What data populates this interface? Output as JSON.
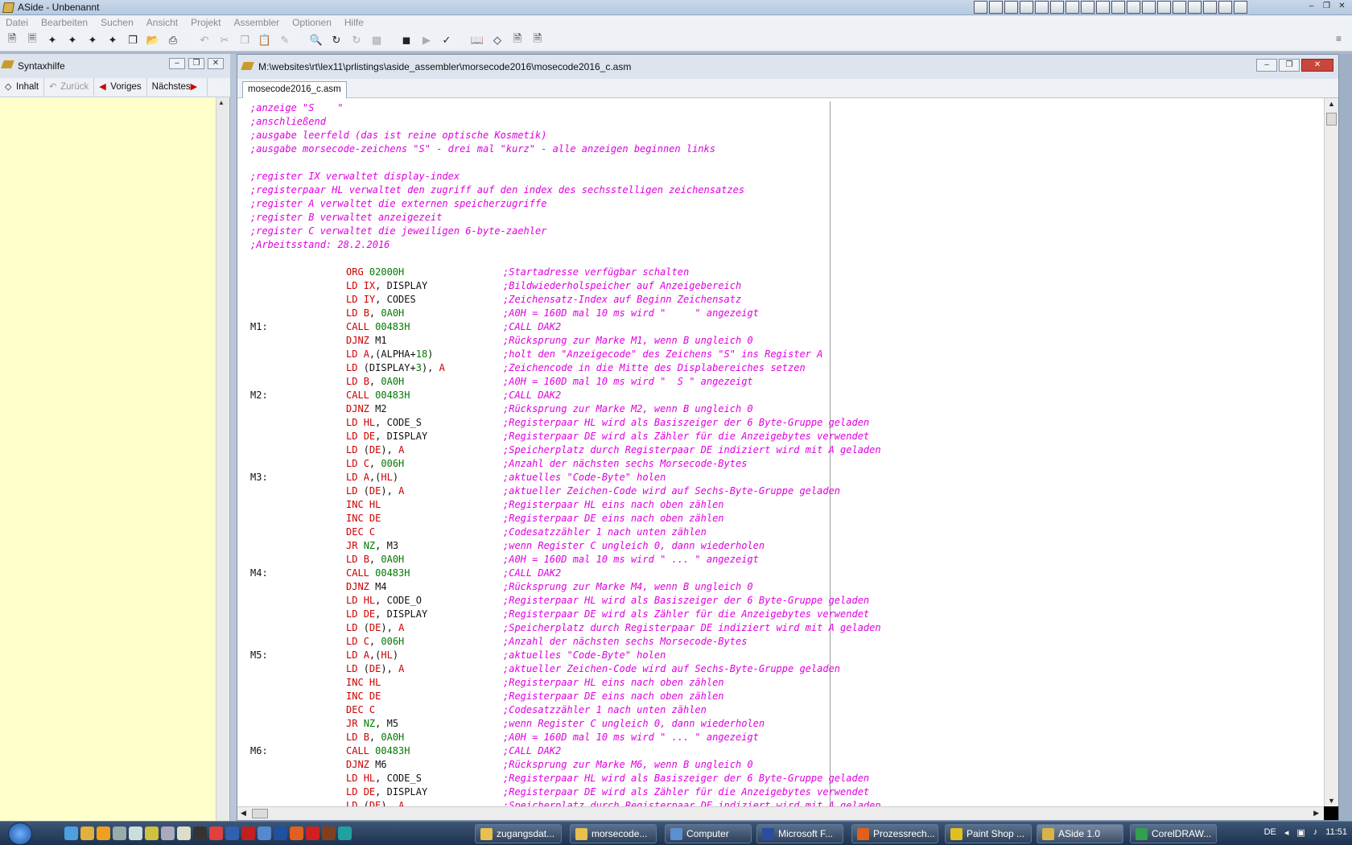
{
  "window": {
    "title": "ASide - Unbenannt"
  },
  "menu": [
    "Datei",
    "Bearbeiten",
    "Suchen",
    "Ansicht",
    "Projekt",
    "Assembler",
    "Optionen",
    "Hilfe"
  ],
  "left_panel": {
    "title": "Syntaxhilfe",
    "buttons": {
      "contents": "Inhalt",
      "back": "Zurück",
      "prev": "Voriges",
      "next": "Nächstes"
    }
  },
  "editor": {
    "path": "M:\\websites\\rt\\lex11\\prlistings\\aside_assembler\\morsecode2016\\mosecode2016_c.asm",
    "tab": "mosecode2016_c.asm",
    "header_comments": [
      ";anzeige \"S    \"",
      ";anschließend",
      ";ausgabe leerfeld (das ist reine optische Kosmetik)",
      ";ausgabe morsecode-zeichens \"S\" - drei mal \"kurz\" - alle anzeigen beginnen links",
      "",
      ";register IX verwaltet display-index",
      ";registerpaar HL verwaltet den zugriff auf den index des sechsstelligen zeichensatzes",
      ";register A verwaltet die externen speicherzugriffe",
      ";register B verwaltet anzeigezeit",
      ";register C verwaltet die jeweiligen 6-byte-zaehler",
      ";Arbeitsstand: 28.2.2016",
      ""
    ],
    "code": [
      {
        "label": "",
        "op": "ORG",
        "args": [
          [
            "num",
            "02000H"
          ]
        ],
        "comment": ";Startadresse verfügbar schalten"
      },
      {
        "label": "",
        "op": "LD",
        "args": [
          [
            "rg",
            "IX"
          ],
          [
            "op",
            ", DISPLAY"
          ]
        ],
        "comment": ";Bildwiederholspeicher auf Anzeigebereich"
      },
      {
        "label": "",
        "op": "LD",
        "args": [
          [
            "rg",
            "IY"
          ],
          [
            "op",
            ", CODES"
          ]
        ],
        "comment": ";Zeichensatz-Index auf Beginn Zeichensatz"
      },
      {
        "label": "",
        "op": "LD",
        "args": [
          [
            "rg",
            "B"
          ],
          [
            "op",
            ", "
          ],
          [
            "num",
            "0A0H"
          ]
        ],
        "comment": ";A0H = 160D mal 10 ms wird \"     \" angezeigt"
      },
      {
        "label": "M1:",
        "op": "CALL",
        "args": [
          [
            "num",
            "00483H"
          ]
        ],
        "comment": ";CALL DAK2"
      },
      {
        "label": "",
        "op": "DJNZ",
        "args": [
          [
            "op",
            "M1"
          ]
        ],
        "comment": ";Rücksprung zur Marke M1, wenn B ungleich 0"
      },
      {
        "label": "",
        "op": "LD",
        "args": [
          [
            "rg",
            "A"
          ],
          [
            "op",
            ",(ALPHA+"
          ],
          [
            "num",
            "18"
          ],
          [
            "op",
            ")"
          ]
        ],
        "comment": ";holt den \"Anzeigecode\" des Zeichens \"S\" ins Register A"
      },
      {
        "label": "",
        "op": "LD",
        "args": [
          [
            "op",
            "(DISPLAY+"
          ],
          [
            "num",
            "3"
          ],
          [
            "op",
            "), "
          ],
          [
            "rg",
            "A"
          ]
        ],
        "comment": ";Zeichencode in die Mitte des Displabereiches setzen"
      },
      {
        "label": "",
        "op": "LD",
        "args": [
          [
            "rg",
            "B"
          ],
          [
            "op",
            ", "
          ],
          [
            "num",
            "0A0H"
          ]
        ],
        "comment": ";A0H = 160D mal 10 ms wird \"  S \" angezeigt"
      },
      {
        "label": "M2:",
        "op": "CALL",
        "args": [
          [
            "num",
            "00483H"
          ]
        ],
        "comment": ";CALL DAK2"
      },
      {
        "label": "",
        "op": "DJNZ",
        "args": [
          [
            "op",
            "M2"
          ]
        ],
        "comment": ";Rücksprung zur Marke M2, wenn B ungleich 0"
      },
      {
        "label": "",
        "op": "LD",
        "args": [
          [
            "rg",
            "HL"
          ],
          [
            "op",
            ", CODE_S"
          ]
        ],
        "comment": ";Registerpaar HL wird als Basiszeiger der 6 Byte-Gruppe geladen"
      },
      {
        "label": "",
        "op": "LD",
        "args": [
          [
            "rg",
            "DE"
          ],
          [
            "op",
            ", DISPLAY"
          ]
        ],
        "comment": ";Registerpaar DE wird als Zähler für die Anzeigebytes verwendet"
      },
      {
        "label": "",
        "op": "LD",
        "args": [
          [
            "op",
            "("
          ],
          [
            "rg",
            "DE"
          ],
          [
            "op",
            "), "
          ],
          [
            "rg",
            "A"
          ]
        ],
        "comment": ";Speicherplatz durch Registerpaar DE indiziert wird mit A geladen"
      },
      {
        "label": "",
        "op": "LD",
        "args": [
          [
            "rg",
            "C"
          ],
          [
            "op",
            ", "
          ],
          [
            "num",
            "006H"
          ]
        ],
        "comment": ";Anzahl der nächsten sechs Morsecode-Bytes"
      },
      {
        "label": "M3:",
        "op": "LD",
        "args": [
          [
            "rg",
            "A"
          ],
          [
            "op",
            ",("
          ],
          [
            "rg",
            "HL"
          ],
          [
            "op",
            ")"
          ]
        ],
        "comment": ";aktuelles \"Code-Byte\" holen"
      },
      {
        "label": "",
        "op": "LD",
        "args": [
          [
            "op",
            "("
          ],
          [
            "rg",
            "DE"
          ],
          [
            "op",
            "), "
          ],
          [
            "rg",
            "A"
          ]
        ],
        "comment": ";aktueller Zeichen-Code wird auf Sechs-Byte-Gruppe geladen"
      },
      {
        "label": "",
        "op": "INC",
        "args": [
          [
            "rg",
            "HL"
          ]
        ],
        "comment": ";Registerpaar HL eins nach oben zählen"
      },
      {
        "label": "",
        "op": "INC",
        "args": [
          [
            "rg",
            "DE"
          ]
        ],
        "comment": ";Registerpaar DE eins nach oben zählen"
      },
      {
        "label": "",
        "op": "DEC",
        "args": [
          [
            "rg",
            "C"
          ]
        ],
        "comment": ";Codesatzzähler 1 nach unten zählen"
      },
      {
        "label": "",
        "op": "JR",
        "args": [
          [
            "num",
            "NZ"
          ],
          [
            "op",
            ", M3"
          ]
        ],
        "comment": ";wenn Register C ungleich 0, dann wiederholen"
      },
      {
        "label": "",
        "op": "LD",
        "args": [
          [
            "rg",
            "B"
          ],
          [
            "op",
            ", "
          ],
          [
            "num",
            "0A0H"
          ]
        ],
        "comment": ";A0H = 160D mal 10 ms wird \" ... \" angezeigt"
      },
      {
        "label": "M4:",
        "op": "CALL",
        "args": [
          [
            "num",
            "00483H"
          ]
        ],
        "comment": ";CALL DAK2"
      },
      {
        "label": "",
        "op": "DJNZ",
        "args": [
          [
            "op",
            "M4"
          ]
        ],
        "comment": ";Rücksprung zur Marke M4, wenn B ungleich 0"
      },
      {
        "label": "",
        "op": "LD",
        "args": [
          [
            "rg",
            "HL"
          ],
          [
            "op",
            ", CODE_O"
          ]
        ],
        "comment": ";Registerpaar HL wird als Basiszeiger der 6 Byte-Gruppe geladen"
      },
      {
        "label": "",
        "op": "LD",
        "args": [
          [
            "rg",
            "DE"
          ],
          [
            "op",
            ", DISPLAY"
          ]
        ],
        "comment": ";Registerpaar DE wird als Zähler für die Anzeigebytes verwendet"
      },
      {
        "label": "",
        "op": "LD",
        "args": [
          [
            "op",
            "("
          ],
          [
            "rg",
            "DE"
          ],
          [
            "op",
            "), "
          ],
          [
            "rg",
            "A"
          ]
        ],
        "comment": ";Speicherplatz durch Registerpaar DE indiziert wird mit A geladen"
      },
      {
        "label": "",
        "op": "LD",
        "args": [
          [
            "rg",
            "C"
          ],
          [
            "op",
            ", "
          ],
          [
            "num",
            "006H"
          ]
        ],
        "comment": ";Anzahl der nächsten sechs Morsecode-Bytes"
      },
      {
        "label": "M5:",
        "op": "LD",
        "args": [
          [
            "rg",
            "A"
          ],
          [
            "op",
            ",("
          ],
          [
            "rg",
            "HL"
          ],
          [
            "op",
            ")"
          ]
        ],
        "comment": ";aktuelles \"Code-Byte\" holen"
      },
      {
        "label": "",
        "op": "LD",
        "args": [
          [
            "op",
            "("
          ],
          [
            "rg",
            "DE"
          ],
          [
            "op",
            "), "
          ],
          [
            "rg",
            "A"
          ]
        ],
        "comment": ";aktueller Zeichen-Code wird auf Sechs-Byte-Gruppe geladen"
      },
      {
        "label": "",
        "op": "INC",
        "args": [
          [
            "rg",
            "HL"
          ]
        ],
        "comment": ";Registerpaar HL eins nach oben zählen"
      },
      {
        "label": "",
        "op": "INC",
        "args": [
          [
            "rg",
            "DE"
          ]
        ],
        "comment": ";Registerpaar DE eins nach oben zählen"
      },
      {
        "label": "",
        "op": "DEC",
        "args": [
          [
            "rg",
            "C"
          ]
        ],
        "comment": ";Codesatzzähler 1 nach unten zählen"
      },
      {
        "label": "",
        "op": "JR",
        "args": [
          [
            "num",
            "NZ"
          ],
          [
            "op",
            ", M5"
          ]
        ],
        "comment": ";wenn Register C ungleich 0, dann wiederholen"
      },
      {
        "label": "",
        "op": "LD",
        "args": [
          [
            "rg",
            "B"
          ],
          [
            "op",
            ", "
          ],
          [
            "num",
            "0A0H"
          ]
        ],
        "comment": ";A0H = 160D mal 10 ms wird \" ... \" angezeigt"
      },
      {
        "label": "M6:",
        "op": "CALL",
        "args": [
          [
            "num",
            "00483H"
          ]
        ],
        "comment": ";CALL DAK2"
      },
      {
        "label": "",
        "op": "DJNZ",
        "args": [
          [
            "op",
            "M6"
          ]
        ],
        "comment": ";Rücksprung zur Marke M6, wenn B ungleich 0"
      },
      {
        "label": "",
        "op": "LD",
        "args": [
          [
            "rg",
            "HL"
          ],
          [
            "op",
            ", CODE_S"
          ]
        ],
        "comment": ";Registerpaar HL wird als Basiszeiger der 6 Byte-Gruppe geladen"
      },
      {
        "label": "",
        "op": "LD",
        "args": [
          [
            "rg",
            "DE"
          ],
          [
            "op",
            ", DISPLAY"
          ]
        ],
        "comment": ";Registerpaar DE wird als Zähler für die Anzeigebytes verwendet"
      },
      {
        "label": "",
        "op": "LD",
        "args": [
          [
            "op",
            "("
          ],
          [
            "rg",
            "DE"
          ],
          [
            "op",
            "), "
          ],
          [
            "rg",
            "A"
          ]
        ],
        "comment": ";Speicherplatz durch Registerpaar DE indiziert wird mit A geladen"
      }
    ]
  },
  "taskbar": {
    "tasks": [
      "zugangsdat...",
      "morsecode...",
      "Computer",
      "Microsoft F...",
      "Prozessrech...",
      "Paint Shop ...",
      "ASide 1.0",
      "CorelDRAW..."
    ],
    "language": "DE",
    "clock": "11:51"
  },
  "colors": {
    "comment": "#e000e0",
    "keyword": "#cc0000",
    "number": "#007a00",
    "help_background": "#ffffcc"
  }
}
